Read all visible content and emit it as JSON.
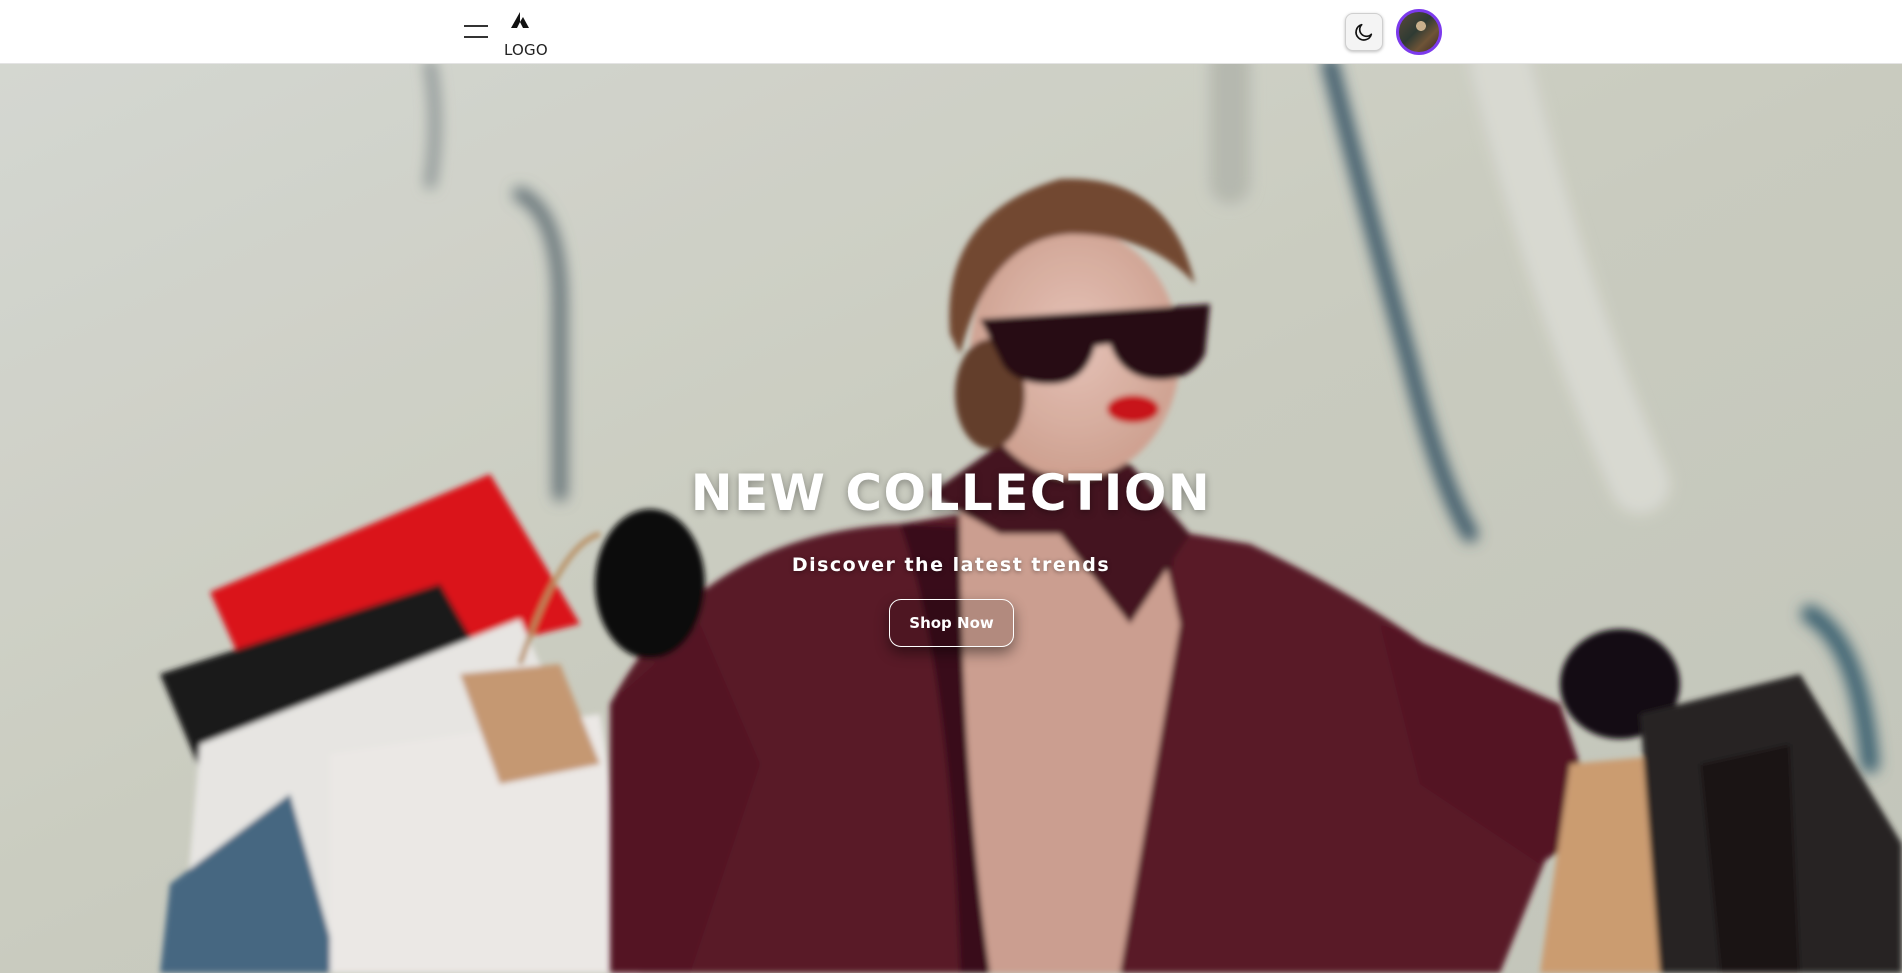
{
  "header": {
    "menu_icon": "hamburger-menu-icon",
    "logo_icon": "triangle-logo-icon",
    "logo_text": "LOGO",
    "theme_icon": "moon-icon",
    "avatar_icon": "user-avatar"
  },
  "hero": {
    "title": "NEW COLLECTION",
    "subtitle": "Discover the latest trends",
    "cta_label": "Shop Now"
  },
  "colors": {
    "avatar_ring": "#7c3aed",
    "coat": "#5e1a2b",
    "background": "#d9dccf"
  }
}
